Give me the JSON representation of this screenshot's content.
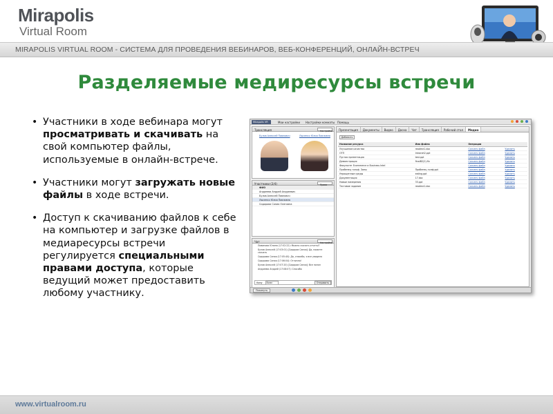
{
  "brand": {
    "line1": "Mirapolis",
    "line2": "Virtual Room"
  },
  "header": {
    "bar_text": "MIRAPOLIS VIRTUAL ROOM - СИСТЕМА ДЛЯ ПРОВЕДЕНИЯ ВЕБИНАРОВ, ВЕБ-КОНФЕРЕНЦИЙ, ОНЛАЙН-ВСТРЕЧ"
  },
  "slide": {
    "title": "Разделяемые медиресурсы встречи",
    "bullets": [
      {
        "pre": "Участники в ходе вебинара могут ",
        "bold": "просматривать и скачивать",
        "post": " на свой компьютер файлы, используемые в онлайн-встрече."
      },
      {
        "pre": "Участники могут ",
        "bold": "загружать новые файлы",
        "post": " в ходе встречи."
      },
      {
        "pre": "Доступ к скачиванию файлов к себе на компьютер и загрузке файлов в медиаресурсы встречи регулируется ",
        "bold": "специальными правами доступа",
        "post": ", которые ведущий может предоставить любому участнику."
      }
    ]
  },
  "app": {
    "menu": [
      "Mirapolis VR",
      "Мои настройки",
      "Настройки комнаты",
      "Помощь"
    ],
    "video_panel_title": "Трансляция",
    "video_panel_select": "Настройки",
    "participants_panel_title": "Участники (2/4)",
    "participants_panel_select": "Права",
    "participants_header": "ФИО",
    "participants": [
      "Андреева Андрей Андреевич",
      "Булов Алексей Павлович",
      "Лысенко Юлия Павловна",
      "Сидорова Сания Олеговна"
    ],
    "chat_panel_title": "Чат",
    "chat_panel_select": "Настройки",
    "chat_messages": [
      "Ливанова Юлина (17:02:22): Можно скачать отчеты?",
      "Булов Алексей (17:03:01) [Сидоров Сания]: Да, можете скачать",
      "Сидорова Сания (17:05:40): Да, спасибо, я все увидела",
      "Сидорова Сания (17:06:04): Отлично!",
      "Булов Алексей (17:07:20) [Сидоров Сания]: Все понял",
      "Андреева Андрей (17:08:07): Спасибо"
    ],
    "chat_to_label": "Кому",
    "chat_to_value": "Всем",
    "chat_send": "Отправить",
    "bottom_bar_button": "Покинуть",
    "tabs": [
      "Презентация",
      "Документы",
      "Видео",
      "Доска",
      "Чат",
      "Трансляция",
      "Рабочий стол",
      "Медиа"
    ],
    "active_tab_index": 7,
    "add_button": "Добавить",
    "table_headers": [
      "Название ресурса",
      "Имя файла",
      "Операции"
    ],
    "table_rows": [
      [
        "Улучшение качества",
        "readme1.doc",
        "Скачать файл",
        "Удалить"
      ],
      [
        "ОТП",
        "Intranet2.ppt",
        "Скачать файл",
        "Удалить"
      ],
      [
        "Пустая презентация",
        "test.ppt",
        "Скачать файл",
        "Удалить"
      ],
      [
        "Демонстрация",
        "finalB2(2).flv",
        "Скачать файл",
        "Удалить"
      ],
      [
        "Факультет Ecommerce и Business Intel",
        "",
        "Скачать файл",
        "Удалить"
      ],
      [
        "Пробенец гольф. Заны",
        "Пробенец голф.ppt",
        "Скачать файл",
        "Удалить"
      ],
      [
        "Упрощенные среды",
        "eating.ppt",
        "Скачать файл",
        "Удалить"
      ],
      [
        "Документация",
        "17.doc",
        "Скачать файл",
        "Удалить"
      ],
      [
        "Новые намерения",
        "33.ppt",
        "Скачать файл",
        "Удалить"
      ],
      [
        "Тестовое задание",
        "readme1.doc",
        "Скачать файл",
        "Удалить"
      ]
    ],
    "status_colors": [
      "#f2a43a",
      "#d94c3a",
      "#6ab04c",
      "#3e7cc7"
    ]
  },
  "footer": {
    "url": "www.virtualroom.ru"
  },
  "colors": {
    "title": "#2f8a3c",
    "footer_link": "#5e7a9a"
  }
}
